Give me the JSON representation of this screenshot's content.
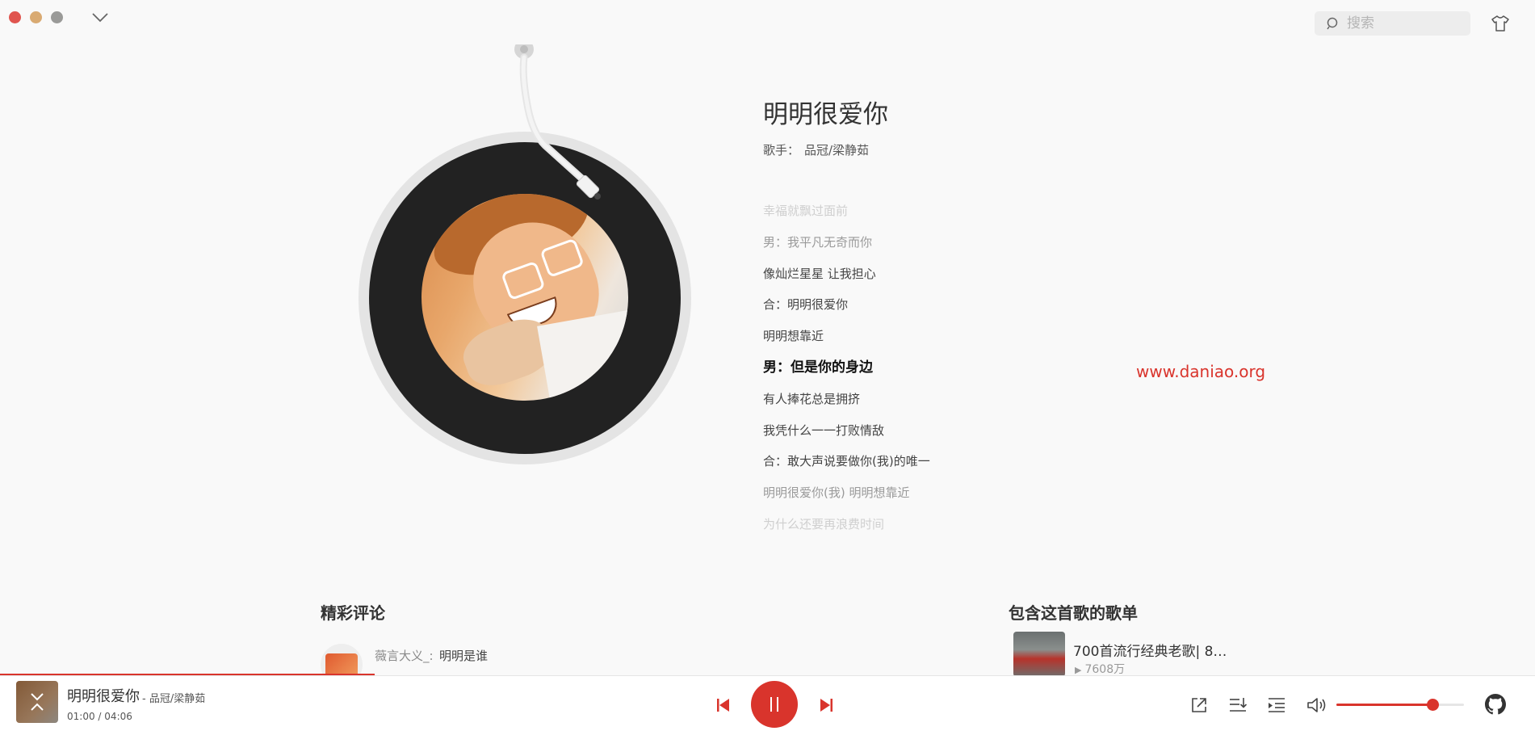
{
  "window": {
    "controls": [
      {
        "name": "close",
        "color": "#e0554f"
      },
      {
        "name": "minimize",
        "color": "#d9aa72"
      },
      {
        "name": "maximize",
        "color": "#9a9a98"
      }
    ]
  },
  "search": {
    "placeholder": "搜索"
  },
  "song": {
    "title": "明明很爱你",
    "singer_label": "歌手：",
    "singer": "品冠/梁静茹"
  },
  "lyrics": [
    {
      "text": "幸福就飘过面前",
      "state": "fade2"
    },
    {
      "text": "男：我平凡无奇而你",
      "state": "fade1"
    },
    {
      "text": "像灿烂星星 让我担心",
      "state": "normal"
    },
    {
      "text": "合：明明很爱你",
      "state": "normal"
    },
    {
      "text": "明明想靠近",
      "state": "normal"
    },
    {
      "text": "男：但是你的身边",
      "state": "active"
    },
    {
      "text": "有人捧花总是拥挤",
      "state": "normal"
    },
    {
      "text": "我凭什么一一打败情敌",
      "state": "normal"
    },
    {
      "text": "合：敢大声说要做你(我)的唯一",
      "state": "normal"
    },
    {
      "text": "明明很爱你(我) 明明想靠近",
      "state": "fade1"
    },
    {
      "text": "为什么还要再浪费时间",
      "state": "fade2"
    }
  ],
  "watermark": "www.daniao.org",
  "comments": {
    "title": "精彩评论",
    "items": [
      {
        "user": "薇言大义_:",
        "text": "明明是谁"
      }
    ]
  },
  "playlists": {
    "title": "包含这首歌的歌单",
    "items": [
      {
        "title": "700首流行经典老歌| 8…",
        "plays": "7608万"
      }
    ]
  },
  "player": {
    "title": "明明很爱你",
    "artist": "- 品冠/梁静茹",
    "current_time": "01:00",
    "separator": "/",
    "duration": "04:06",
    "progress": 0.244,
    "volume": 0.75,
    "accent": "#d9342c"
  }
}
